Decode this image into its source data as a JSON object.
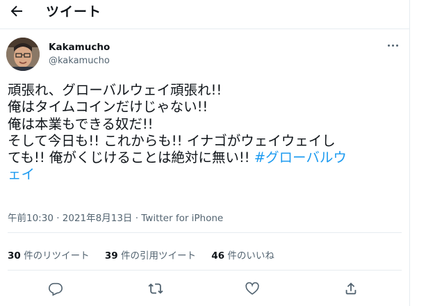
{
  "header": {
    "title": "ツイート",
    "back_icon": "arrow-left-icon"
  },
  "tweet": {
    "author": {
      "name": "Kakamucho",
      "handle": "@kakamucho"
    },
    "more_icon": "more-horizontal-icon",
    "text_lines": [
      "頑張れ、グローバルウェイ頑張れ!!",
      "俺はタイムコインだけじゃない!!",
      "俺は本業もできる奴だ!!",
      "そして今日も!! これからも!! イナゴがウェイウェイし",
      "ても!! 俺がくじけることは絶対に無い!! "
    ],
    "hashtag_line1": "#グローバルウ",
    "hashtag_line2": "ェイ",
    "meta": "午前10:30 · 2021年8月13日 · Twitter for iPhone",
    "stats": [
      {
        "count": "30",
        "label": "件のリツイート"
      },
      {
        "count": "39",
        "label": "件の引用ツイート"
      },
      {
        "count": "46",
        "label": "件のいいね"
      }
    ]
  },
  "actions": [
    "reply-icon",
    "retweet-icon",
    "like-icon",
    "share-icon"
  ],
  "colors": {
    "link": "#1d9bf0",
    "secondary": "#536471",
    "text": "#0f1419",
    "divider": "#e6ecf0"
  }
}
